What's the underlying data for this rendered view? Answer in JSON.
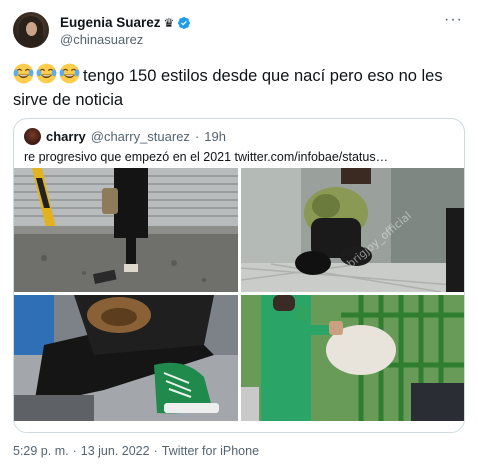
{
  "author": {
    "display_name": "Eugenia Suarez",
    "handle": "@chinasuarez",
    "crown_glyph": "♛",
    "verified_color": "#1d9bf0"
  },
  "tweet": {
    "emojis": [
      "face-with-tears-of-joy",
      "face-with-tears-of-joy",
      "face-with-tears-of-joy"
    ],
    "text": "tengo 150 estilos desde que nací pero eso no les sirve de noticia"
  },
  "quoted_tweet": {
    "display_name": "charry",
    "handle": "@charry_stuarez",
    "separator": "·",
    "age": "19h",
    "text": "re progresivo que empezó en el 2021  twitter.com/infobae/status…",
    "photos": [
      "photo-street",
      "photo-elevator",
      "photo-sneakers",
      "photo-green-cage"
    ],
    "watermark": "brigjoy_official"
  },
  "footer": {
    "time": "5:29 p. m.",
    "date": "13 jun. 2022",
    "source": "Twitter for iPhone",
    "separator": "·"
  },
  "colors": {
    "text_primary": "#0f1419",
    "text_secondary": "#536471",
    "border": "#cfd9de",
    "accent": "#1d9bf0"
  }
}
